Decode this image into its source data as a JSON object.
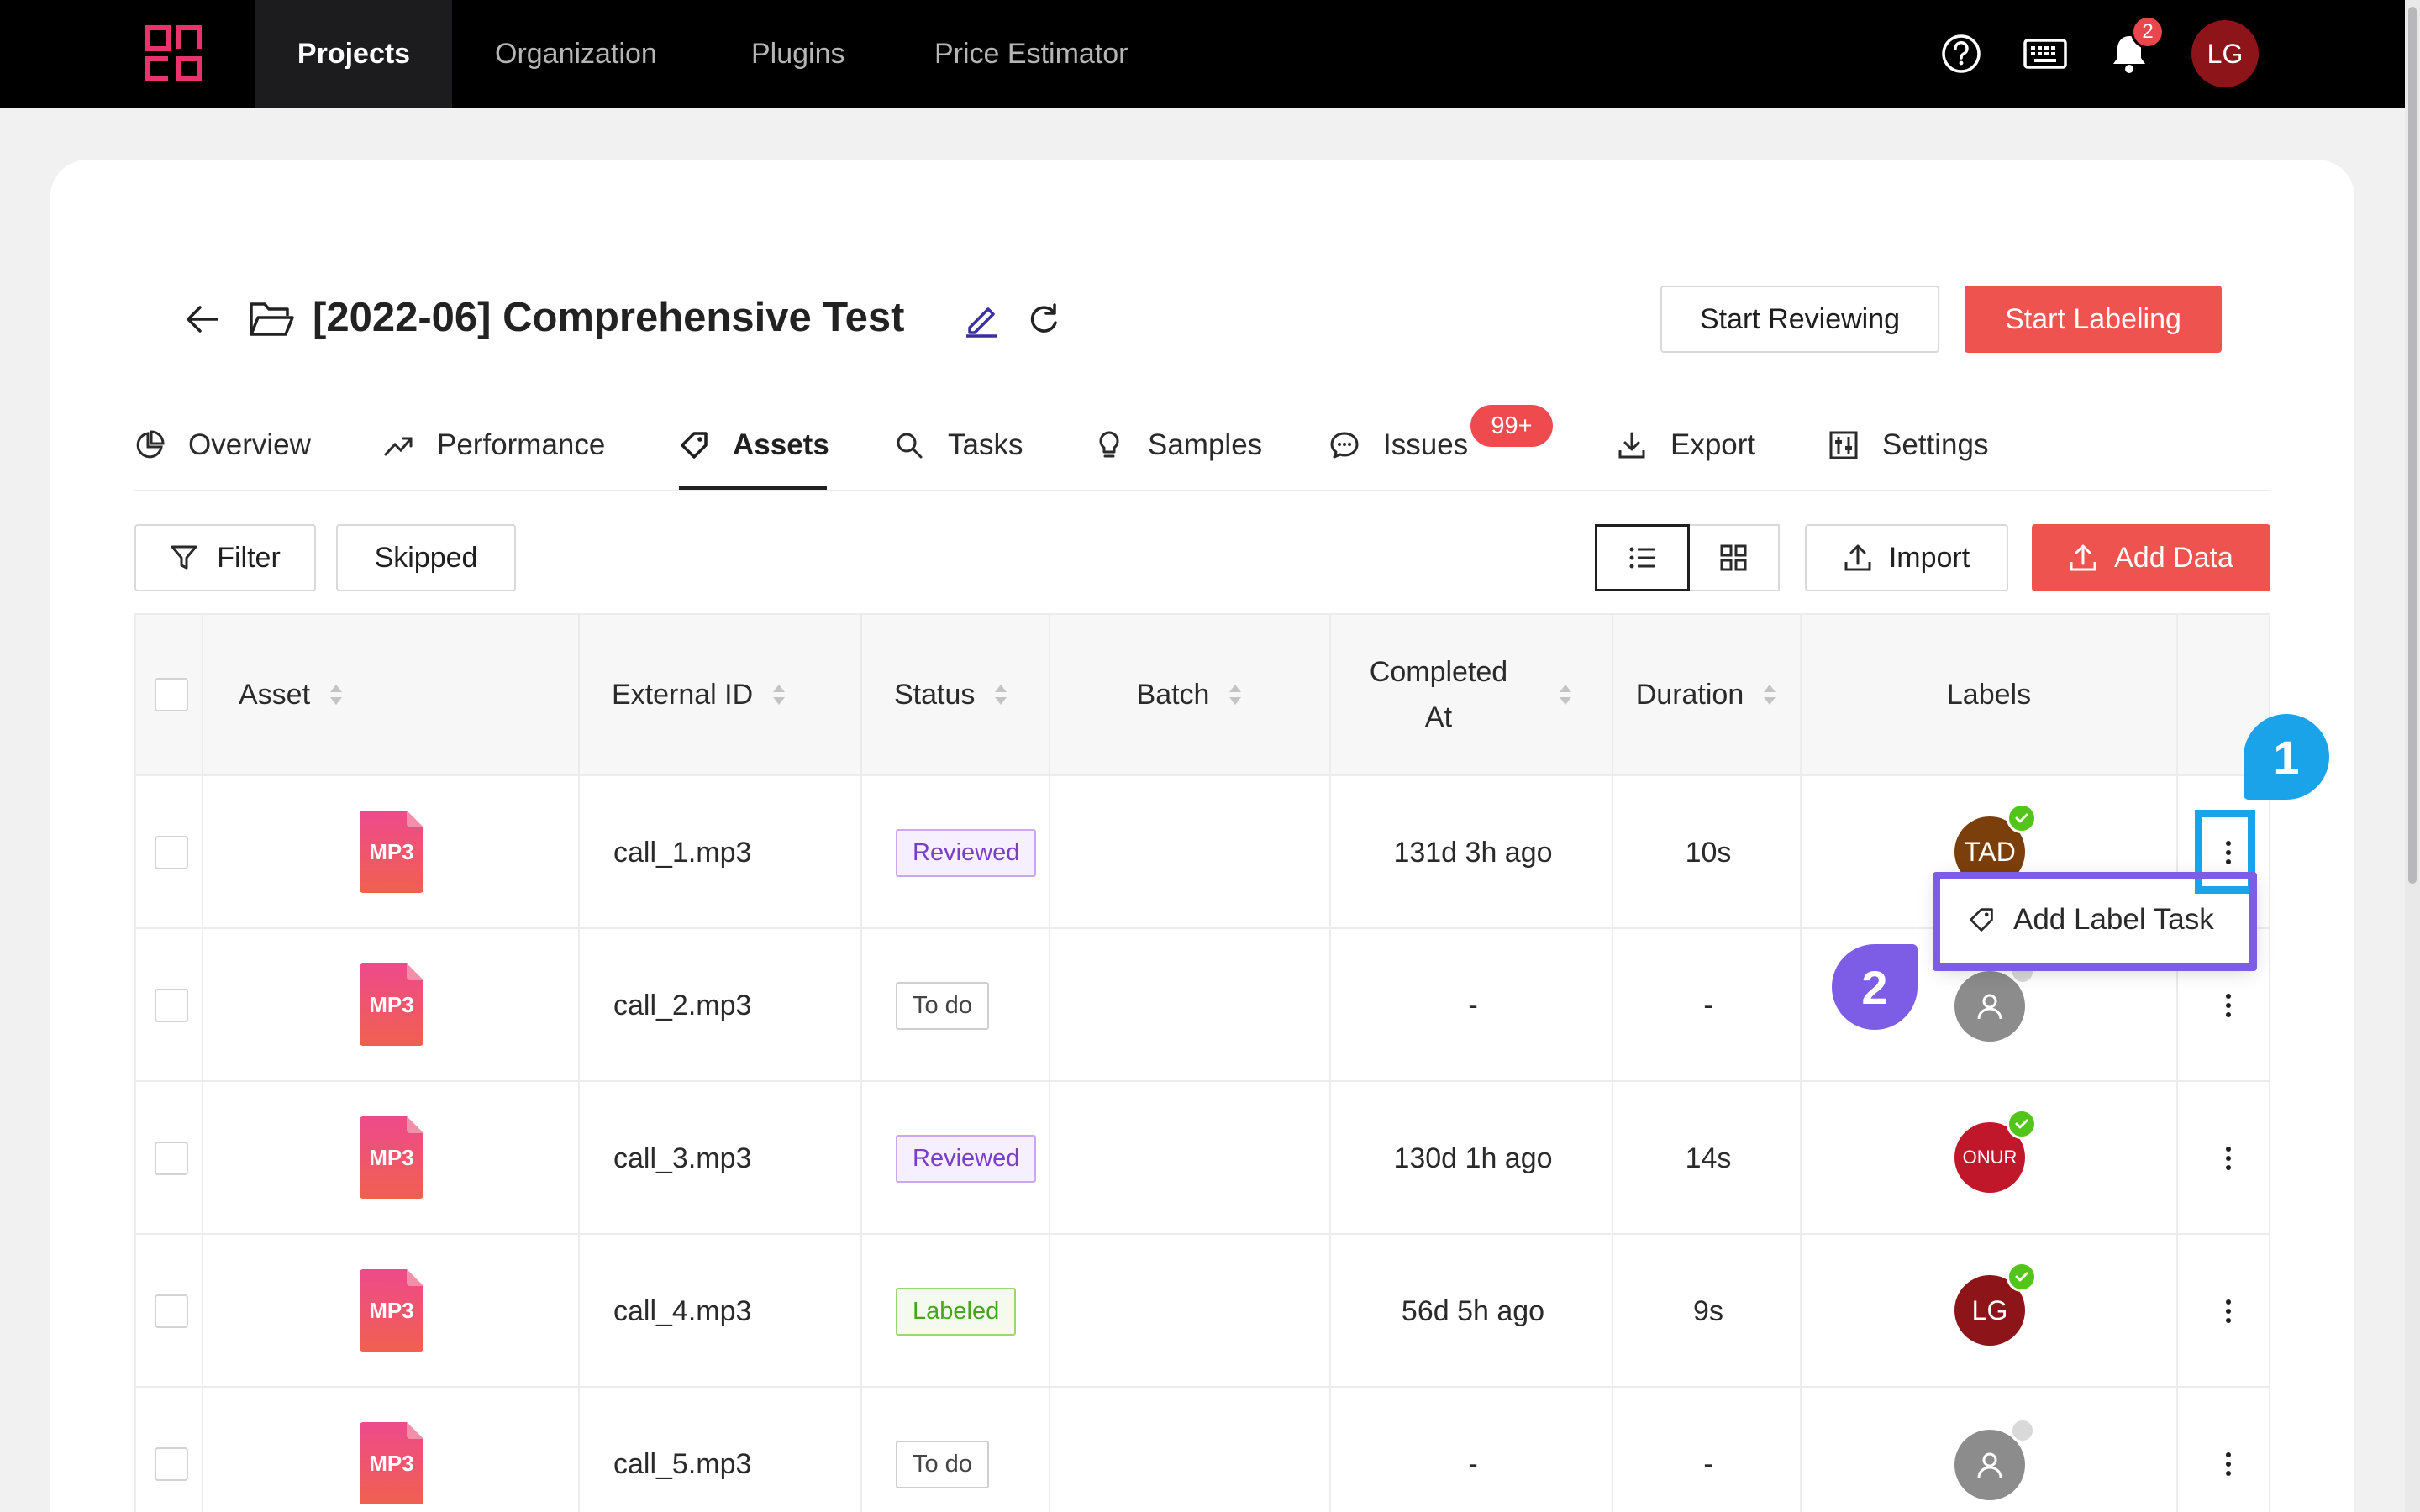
{
  "nav": {
    "items": [
      "Projects",
      "Organization",
      "Plugins",
      "Price Estimator"
    ],
    "notification_count": "2",
    "user_initials": "LG",
    "icons": [
      "help-icon",
      "keyboard-icon",
      "bell-icon"
    ]
  },
  "project": {
    "title": "[2022-06] Comprehensive Test"
  },
  "actions": {
    "start_reviewing": "Start Reviewing",
    "start_labeling": "Start Labeling"
  },
  "tabs": [
    {
      "label": "Overview",
      "icon": "pie-chart-icon"
    },
    {
      "label": "Performance",
      "icon": "trend-icon"
    },
    {
      "label": "Assets",
      "icon": "tag-icon",
      "active": true
    },
    {
      "label": "Tasks",
      "icon": "search-icon"
    },
    {
      "label": "Samples",
      "icon": "bulb-icon"
    },
    {
      "label": "Issues",
      "icon": "chat-icon",
      "badge": "99+"
    },
    {
      "label": "Export",
      "icon": "download-icon"
    },
    {
      "label": "Settings",
      "icon": "sliders-icon"
    }
  ],
  "toolbar": {
    "filter": "Filter",
    "skipped": "Skipped",
    "import": "Import",
    "add_data": "Add Data"
  },
  "table": {
    "headers": {
      "asset": "Asset",
      "external_id": "External ID",
      "status": "Status",
      "batch": "Batch",
      "completed_line1": "Completed",
      "completed_line2": "At",
      "duration": "Duration",
      "labels": "Labels"
    },
    "rows": [
      {
        "file_type": "MP3",
        "external_id": "call_1.mp3",
        "status": "Reviewed",
        "batch": "",
        "completed_at": "131d 3h ago",
        "duration": "10s",
        "labeler": "TAD"
      },
      {
        "file_type": "MP3",
        "external_id": "call_2.mp3",
        "status": "To do",
        "batch": "",
        "completed_at": "-",
        "duration": "-",
        "labeler": ""
      },
      {
        "file_type": "MP3",
        "external_id": "call_3.mp3",
        "status": "Reviewed",
        "batch": "",
        "completed_at": "130d 1h ago",
        "duration": "14s",
        "labeler": "ONUR"
      },
      {
        "file_type": "MP3",
        "external_id": "call_4.mp3",
        "status": "Labeled",
        "batch": "",
        "completed_at": "56d 5h ago",
        "duration": "9s",
        "labeler": "LG"
      },
      {
        "file_type": "MP3",
        "external_id": "call_5.mp3",
        "status": "To do",
        "batch": "",
        "completed_at": "-",
        "duration": "-",
        "labeler": ""
      }
    ]
  },
  "context_menu": {
    "add_label_task": "Add Label Task"
  },
  "annotations": {
    "step1": "1",
    "step2": "2"
  },
  "colors": {
    "accent": "#ef5350",
    "marker_blue": "#1aa3e8",
    "marker_purple": "#7d5ce6",
    "reviewed": "#7a3fc7",
    "labeled": "#46a41d"
  }
}
